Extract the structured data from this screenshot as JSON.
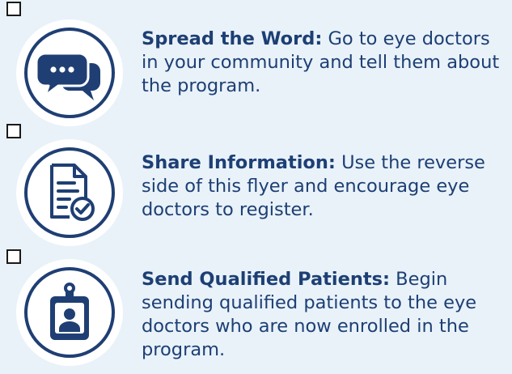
{
  "colors": {
    "background": "#e9f2f9",
    "navy": "#1d3f74",
    "badge_fill": "#ffffff"
  },
  "items": [
    {
      "icon": "speech-bubbles-icon",
      "title": "Spread the Word:",
      "body": "Go to eye doctors in your community and tell them about the program."
    },
    {
      "icon": "document-check-icon",
      "title": "Share Information:",
      "body": "Use the reverse side of this flyer and encourage eye doctors to register."
    },
    {
      "icon": "id-badge-icon",
      "title": "Send Qualified Patients:",
      "body": "Begin sending qualified patients to the eye doctors who are now enrolled in the program."
    }
  ]
}
